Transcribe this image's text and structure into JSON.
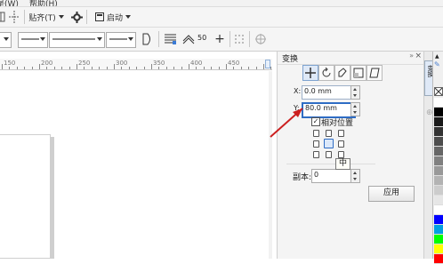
{
  "menubar": {
    "items": [
      "是(W)",
      "帮助(H)"
    ]
  },
  "toolbar1": {
    "snap_label": "贴齐(T)",
    "launch_label": "启动"
  },
  "toolbar2": {
    "outline_width_value": "50"
  },
  "ruler": {
    "labels": [
      "150",
      "200",
      "250",
      "300",
      "350",
      "400",
      "450"
    ]
  },
  "docker": {
    "title": "变换",
    "x_label": "X:",
    "x_value": "0.0 mm",
    "y_label": "Y:",
    "y_value": "80.0 mm",
    "relative_label": "相对位置",
    "relative_checked": true,
    "tooltip": "中",
    "copies_label": "副本:",
    "copies_value": "0",
    "apply_label": "应用",
    "side_tab_label": "变换"
  },
  "palette": {
    "colors": [
      "#ffffff",
      "#000000",
      "#1a1a1a",
      "#333333",
      "#4d4d4d",
      "#666666",
      "#808080",
      "#999999",
      "#b3b3b3",
      "#cccccc",
      "#e6e6e6",
      "#ffffff",
      "#0000ff",
      "#00a0e0",
      "#00ff00",
      "#ffff00",
      "#ff0000"
    ]
  },
  "annotation": {
    "arrow_color": "#cc1f1f"
  }
}
